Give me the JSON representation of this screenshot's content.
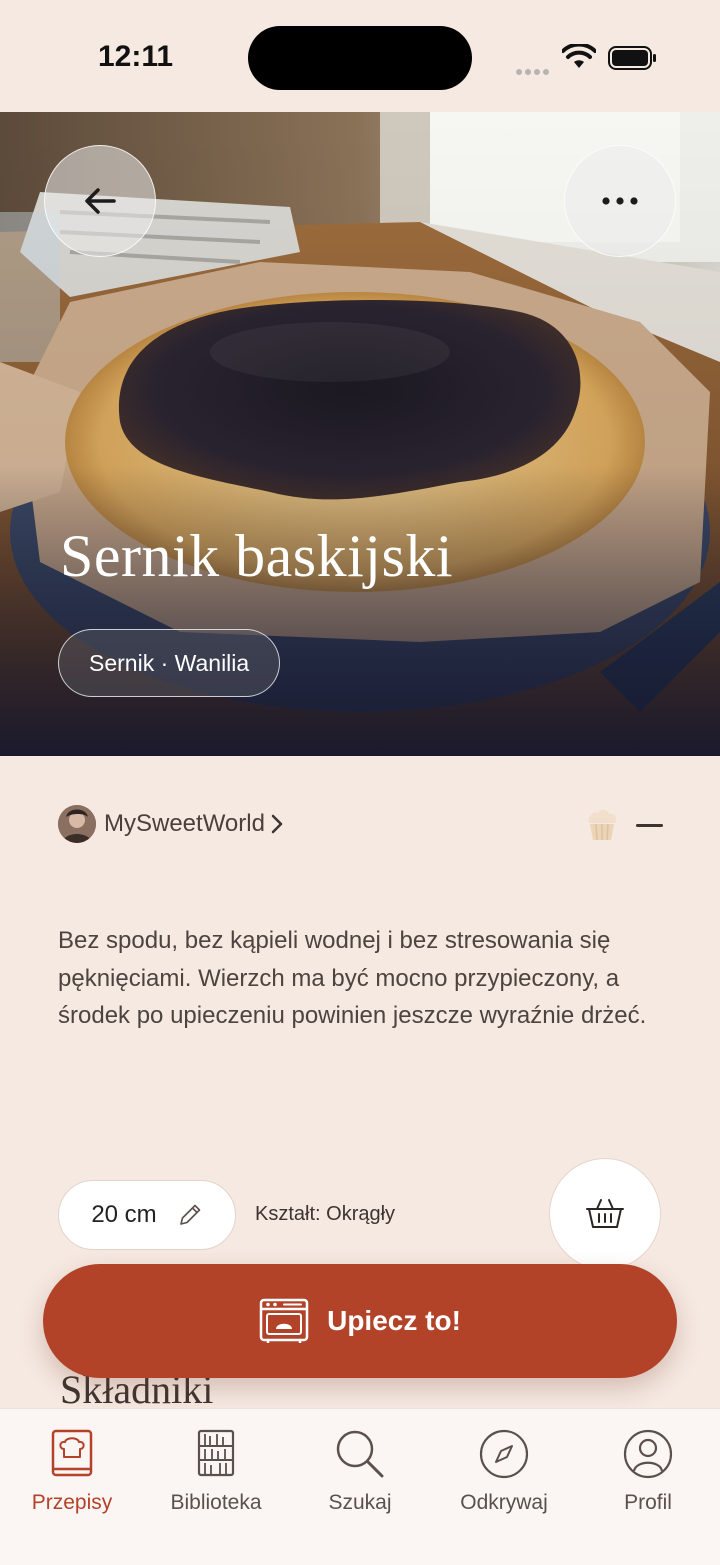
{
  "status_bar": {
    "time": "12:11"
  },
  "hero": {
    "title": "Sernik baskijski",
    "tags": "Sernik · Wanilia"
  },
  "author": {
    "name": "MySweetWorld"
  },
  "rating_placeholder": "—",
  "description": "Bez spodu, bez kąpieli wodnej i bez stresowania się pęknięciami. Wierzch ma być mocno przypieczony, a środek po upieczeniu powinien jeszcze wyraźnie drżeć.",
  "size": {
    "value": "20 cm",
    "shape_label": "Kształt: Okrągły"
  },
  "section": {
    "ingredients_heading": "Składniki"
  },
  "cta": {
    "label": "Upiecz to!"
  },
  "tabs": [
    {
      "label": "Przepisy",
      "icon": "recipe-book-icon",
      "active": true
    },
    {
      "label": "Biblioteka",
      "icon": "bookshelf-icon",
      "active": false
    },
    {
      "label": "Szukaj",
      "icon": "search-icon",
      "active": false
    },
    {
      "label": "Odkrywaj",
      "icon": "compass-icon",
      "active": false
    },
    {
      "label": "Profil",
      "icon": "profile-icon",
      "active": false
    }
  ],
  "colors": {
    "background": "#f5e9e1",
    "accent": "#b24228",
    "tab_bar": "#fbf6f3"
  }
}
